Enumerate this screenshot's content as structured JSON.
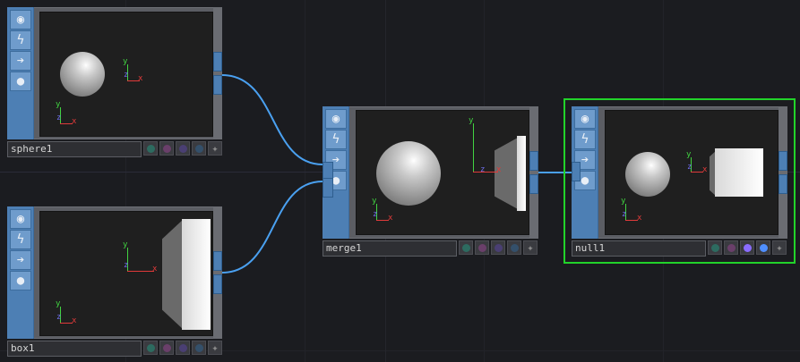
{
  "network": {
    "nodes": [
      {
        "id": "sphere1",
        "label": "sphere1",
        "selected": false,
        "content": "sphere"
      },
      {
        "id": "box1",
        "label": "box1",
        "selected": false,
        "content": "box"
      },
      {
        "id": "merge1",
        "label": "merge1",
        "selected": false,
        "content": "sphere+box"
      },
      {
        "id": "null1",
        "label": "null1",
        "selected": true,
        "content": "sphere+cube"
      }
    ],
    "connections": [
      {
        "from": "sphere1",
        "to": "merge1"
      },
      {
        "from": "box1",
        "to": "merge1"
      },
      {
        "from": "merge1",
        "to": "null1"
      }
    ],
    "left_buttons": [
      "viewer-icon",
      "lightning-icon",
      "arrow-icon",
      "bomb-icon"
    ],
    "axis_labels": {
      "x": "x",
      "y": "y",
      "z": "z"
    },
    "flag_colors": {
      "teal": "#2d6b60",
      "plum": "#6a3f6a",
      "violet": "#4a3f73",
      "slate": "#34506b",
      "violet_on": "#8a6cff",
      "blue_on": "#4f8fff"
    },
    "selection_color": "#22d32a",
    "wire_color": "#4aa0f0"
  }
}
